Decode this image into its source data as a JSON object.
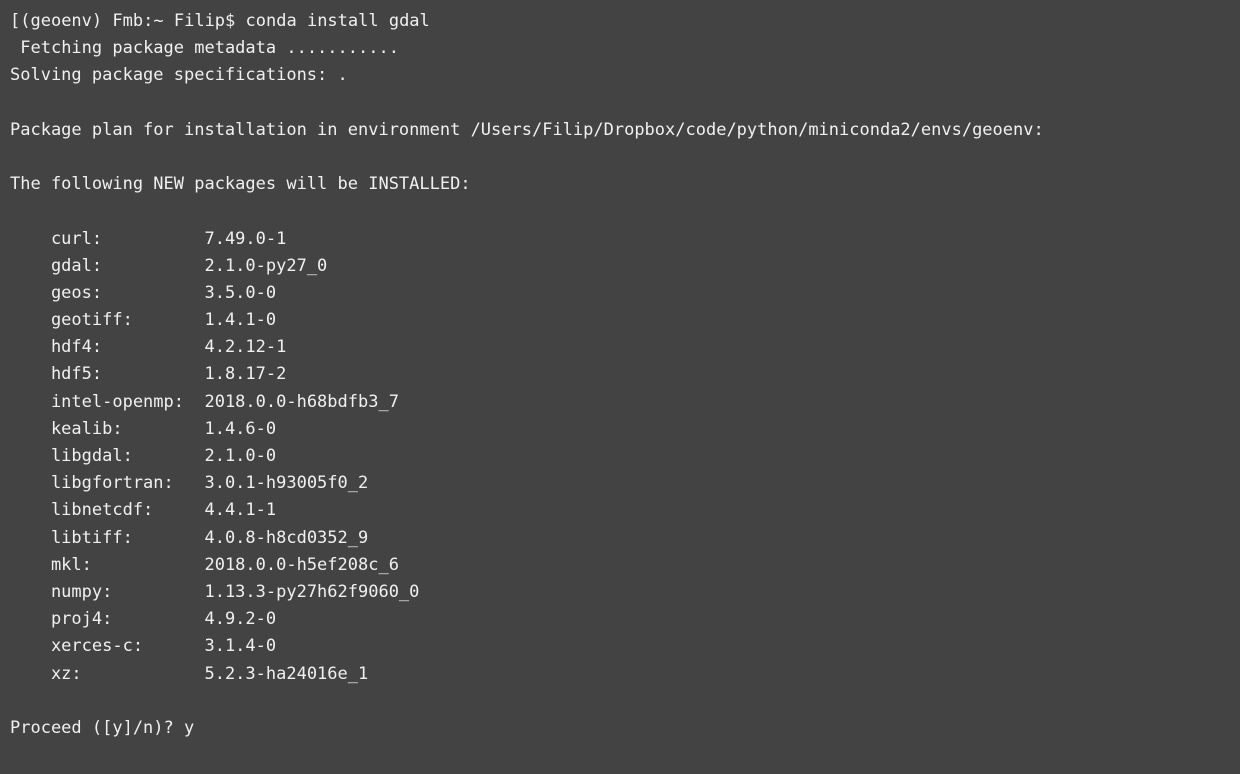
{
  "prompt": {
    "bracket_open": "[",
    "env_name": "(geoenv)",
    "host": "Fmb",
    "sep": ":",
    "path": "~",
    "user": "Filip",
    "dollar": "$",
    "command": "conda install gdal"
  },
  "lines": {
    "fetching": "Fetching package metadata ...........",
    "solving": "Solving package specifications: .",
    "plan": "Package plan for installation in environment /Users/Filip/Dropbox/code/python/miniconda2/envs/geoenv:",
    "new_packages": "The following NEW packages will be INSTALLED:"
  },
  "packages": [
    {
      "name": "curl:",
      "version": "7.49.0-1"
    },
    {
      "name": "gdal:",
      "version": "2.1.0-py27_0"
    },
    {
      "name": "geos:",
      "version": "3.5.0-0"
    },
    {
      "name": "geotiff:",
      "version": "1.4.1-0"
    },
    {
      "name": "hdf4:",
      "version": "4.2.12-1"
    },
    {
      "name": "hdf5:",
      "version": "1.8.17-2"
    },
    {
      "name": "intel-openmp:",
      "version": "2018.0.0-h68bdfb3_7"
    },
    {
      "name": "kealib:",
      "version": "1.4.6-0"
    },
    {
      "name": "libgdal:",
      "version": "2.1.0-0"
    },
    {
      "name": "libgfortran:",
      "version": "3.0.1-h93005f0_2"
    },
    {
      "name": "libnetcdf:",
      "version": "4.4.1-1"
    },
    {
      "name": "libtiff:",
      "version": "4.0.8-h8cd0352_9"
    },
    {
      "name": "mkl:",
      "version": "2018.0.0-h5ef208c_6"
    },
    {
      "name": "numpy:",
      "version": "1.13.3-py27h62f9060_0"
    },
    {
      "name": "proj4:",
      "version": "4.9.2-0"
    },
    {
      "name": "xerces-c:",
      "version": "3.1.4-0"
    },
    {
      "name": "xz:",
      "version": "5.2.3-ha24016e_1"
    }
  ],
  "proceed": {
    "prompt": "Proceed ([y]/n)?",
    "answer": "y"
  }
}
